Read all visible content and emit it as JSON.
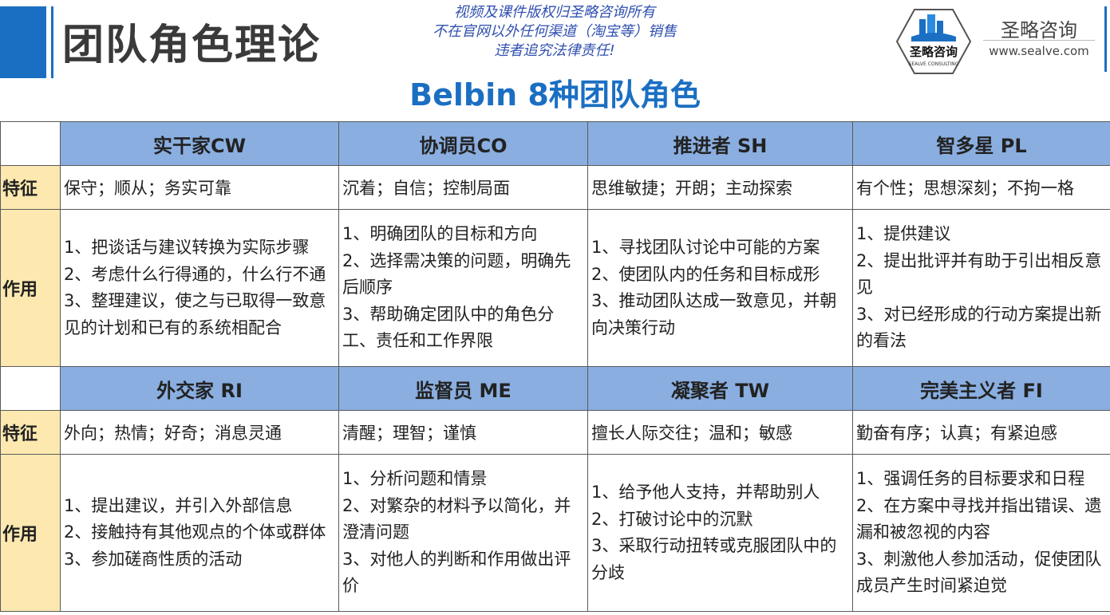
{
  "header": {
    "title": "团队角色理论",
    "subtitle": "Belbin 8种团队角色",
    "notice": [
      "视频及课件版权归圣略咨询所有",
      "不在官网以外任何渠道（淘宝等）销售",
      "违者追究法律责任!"
    ]
  },
  "logo": {
    "badge_text": "圣略咨询",
    "badge_subtext": "SEALVE CONSULTING",
    "name": "圣略咨询",
    "url": "www.sealve.com"
  },
  "row_labels": {
    "trait": "特征",
    "function": "作用"
  },
  "roles_top": [
    {
      "name": "实干家CW",
      "trait": "保守；顺从；务实可靠",
      "functions": [
        "1、把谈话与建议转换为实际步骤",
        "2、考虑什么行得通的，什么行不通",
        "3、整理建议，使之与已取得一致意见的计划和已有的系统相配合"
      ]
    },
    {
      "name": "协调员CO",
      "trait": "沉着；自信；控制局面",
      "functions": [
        "1、明确团队的目标和方向",
        "2、选择需决策的问题，明确先后顺序",
        "3、帮助确定团队中的角色分工、责任和工作界限"
      ]
    },
    {
      "name": "推进者 SH",
      "trait": "思维敏捷；开朗；主动探索",
      "functions": [
        "1、寻找团队讨论中可能的方案",
        "2、使团队内的任务和目标成形",
        "3、推动团队达成一致意见，并朝向决策行动"
      ]
    },
    {
      "name": "智多星 PL",
      "trait": "有个性；思想深刻；不拘一格",
      "functions": [
        "1、提供建议",
        "2、提出批评并有助于引出相反意见",
        "3、对已经形成的行动方案提出新的看法"
      ]
    }
  ],
  "roles_bottom": [
    {
      "name": "外交家 RI",
      "trait": "外向；热情；好奇；消息灵通",
      "functions": [
        "1、提出建议，并引入外部信息",
        "2、接触持有其他观点的个体或群体",
        "3、参加磋商性质的活动"
      ]
    },
    {
      "name": "监督员 ME",
      "trait": "清醒；理智；谨慎",
      "functions": [
        "1、分析问题和情景",
        "2、对繁杂的材料予以简化，并澄清问题",
        "3、对他人的判断和作用做出评价"
      ]
    },
    {
      "name": "凝聚者 TW",
      "trait": "擅长人际交往；温和；敏感",
      "functions": [
        "1、给予他人支持，并帮助别人",
        "2、打破讨论中的沉默",
        "3、采取行动扭转或克服团队中的分歧"
      ]
    },
    {
      "name": "完美主义者 FI",
      "trait": "勤奋有序；认真；有紧迫感",
      "functions": [
        "1、强调任务的目标要求和日程",
        "2、在方案中寻找并指出错误、遗漏和被忽视的内容",
        "3、刺激他人参加活动，促使团队成员产生时间紧迫觉"
      ]
    }
  ]
}
